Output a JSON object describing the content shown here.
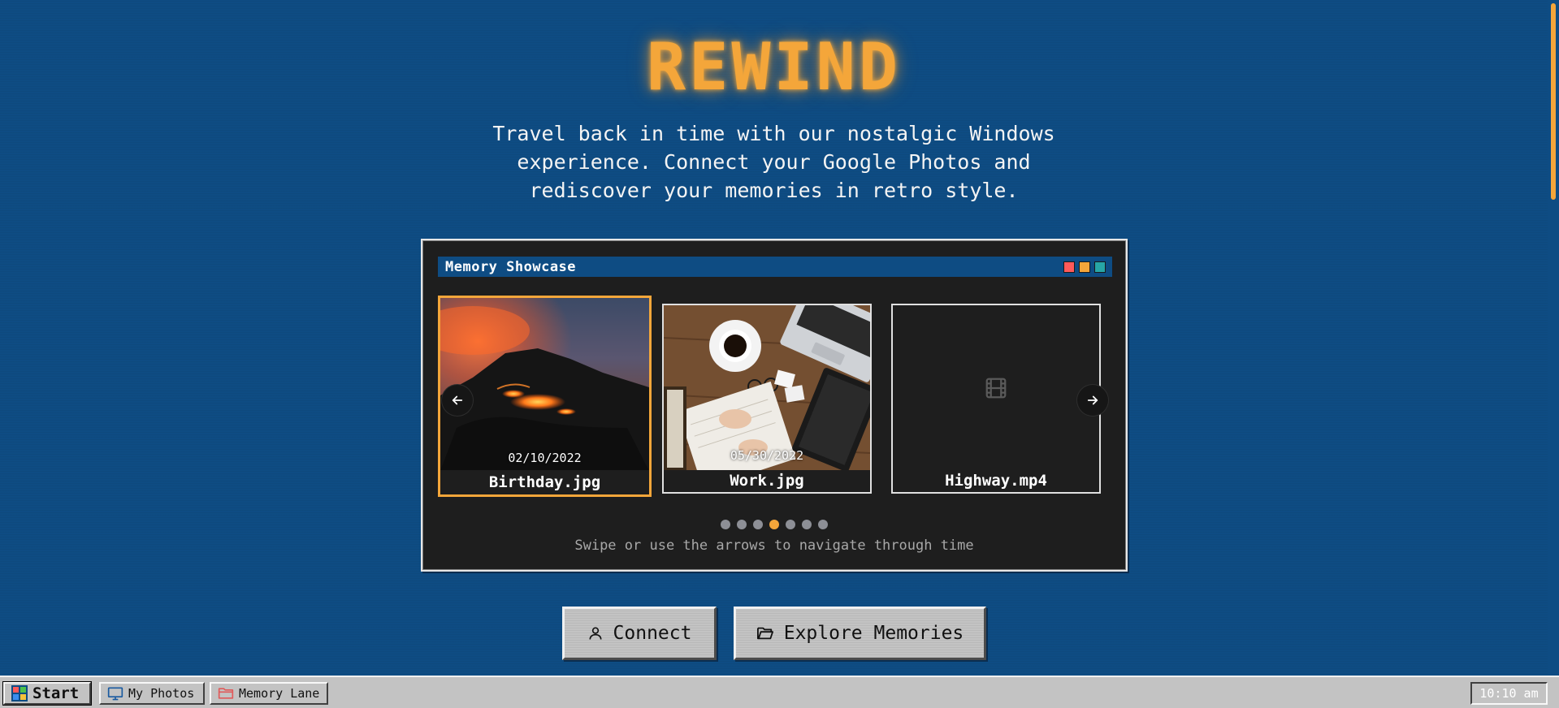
{
  "app": {
    "logo": "REWIND",
    "tagline": "Travel back in time with our nostalgic Windows experience. Connect your Google Photos and rediscover your memories in retro style."
  },
  "showcase": {
    "title": "Memory Showcase",
    "window_controls": [
      {
        "name": "close",
        "color": "#ff5a5a"
      },
      {
        "name": "minimize",
        "color": "#f4a63a"
      },
      {
        "name": "maximize",
        "color": "#27a6a6"
      }
    ],
    "items": [
      {
        "filename": "Birthday.jpg",
        "date": "02/10/2022",
        "kind": "image",
        "selected": true,
        "icon": "volcano-photo"
      },
      {
        "filename": "Work.jpg",
        "date": "05/30/2022",
        "kind": "image",
        "selected": false,
        "icon": "desk-photo"
      },
      {
        "filename": "Highway.mp4",
        "date": "",
        "kind": "video",
        "selected": false,
        "icon": "film-icon"
      }
    ],
    "prev_icon": "arrow-left-icon",
    "next_icon": "arrow-right-icon",
    "pagination": {
      "total": 7,
      "active_index": 3
    },
    "hint": "Swipe or use the arrows to navigate through time"
  },
  "actions": {
    "connect_label": "Connect",
    "connect_icon": "user-icon",
    "explore_label": "Explore Memories",
    "explore_icon": "folder-open-icon"
  },
  "taskbar": {
    "start_label": "Start",
    "items": [
      {
        "label": "My Photos",
        "icon": "monitor-icon"
      },
      {
        "label": "Memory Lane",
        "icon": "folder-icon"
      }
    ],
    "clock": "10:10 am"
  },
  "colors": {
    "desktop": "#0e4c83",
    "accent": "#f4a63a",
    "window_bg": "#1e1e1e",
    "taskbar": "#c3c3c3"
  }
}
